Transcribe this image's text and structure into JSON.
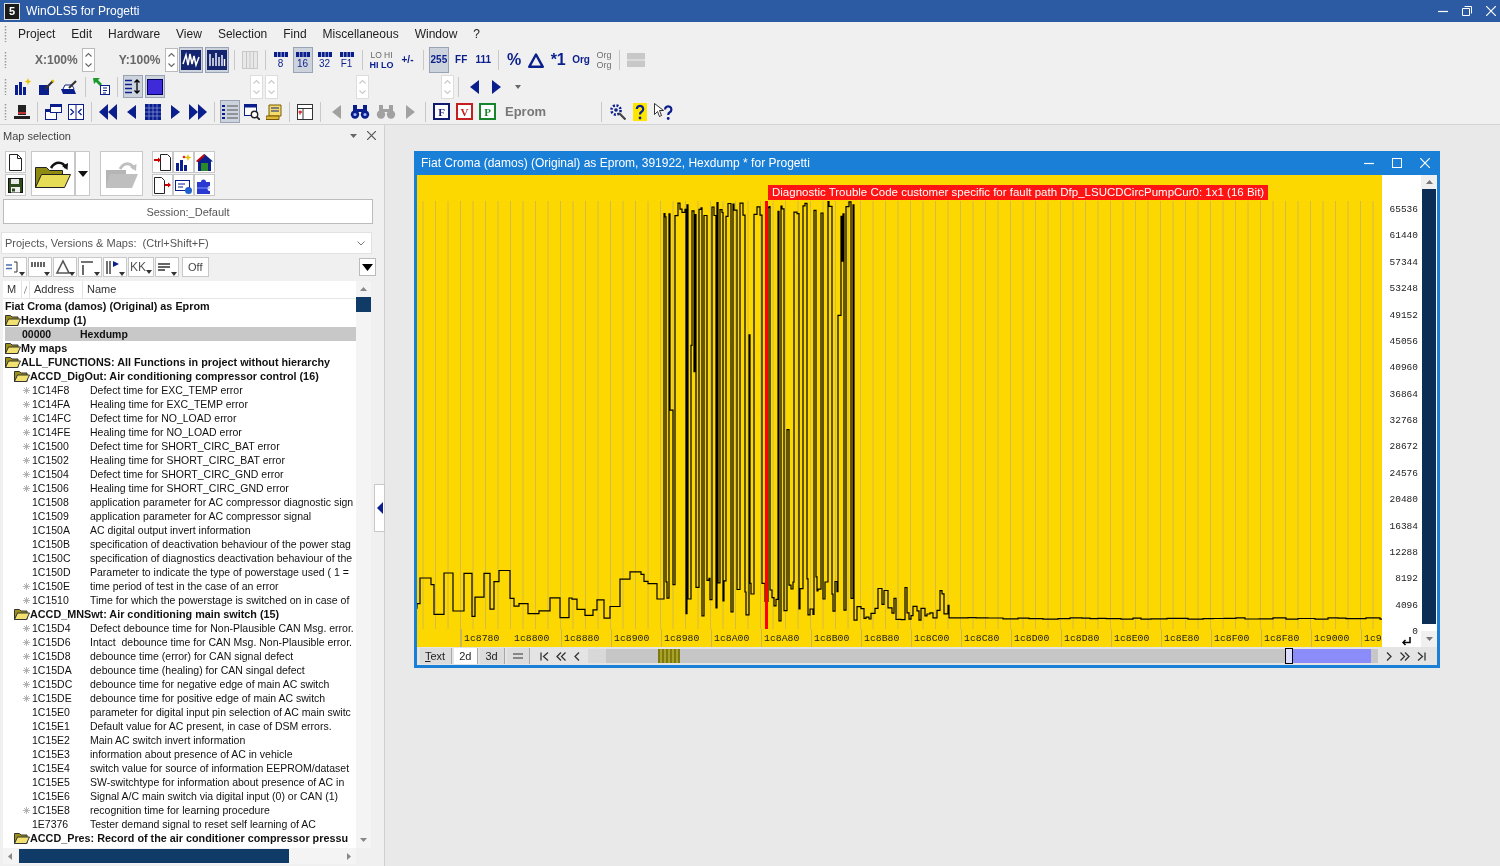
{
  "app": {
    "logo": "5",
    "title": "WinOLS5 for Progetti"
  },
  "menu": [
    "Project",
    "Edit",
    "Hardware",
    "View",
    "Selection",
    "Find",
    "Miscellaneous",
    "Window",
    "?"
  ],
  "toolbar": [
    {
      "items": [
        {
          "kind": "zoom",
          "label": "X:100%"
        },
        {
          "kind": "zoom",
          "label": "Y:100%"
        },
        {
          "kind": "icon",
          "pressed": true,
          "disabled": false
        },
        {
          "kind": "icon",
          "pressed": true,
          "disabled": false
        },
        {
          "kind": "separator"
        },
        {
          "kind": "icon",
          "pressed": false,
          "disabled": true
        },
        {
          "kind": "separator"
        },
        {
          "kind": "bits",
          "label": "8",
          "pressed": false,
          "disabled": false
        },
        {
          "kind": "bits",
          "label": "16",
          "pressed": true,
          "disabled": false
        },
        {
          "kind": "bits",
          "label": "32",
          "pressed": false,
          "disabled": false
        },
        {
          "kind": "bits",
          "label": "F1",
          "pressed": false,
          "disabled": false
        },
        {
          "kind": "separator"
        },
        {
          "kind": "stacked",
          "top": "LO HI",
          "bottom": "HI LO",
          "pressed": false,
          "disabled": false
        },
        {
          "kind": "glyph",
          "label": "+/-",
          "pressed": false,
          "disabled": false
        },
        {
          "kind": "separator"
        },
        {
          "kind": "glyph",
          "label": "255",
          "pressed": true,
          "disabled": false
        },
        {
          "kind": "glyph",
          "label": "FF",
          "pressed": false,
          "disabled": false
        },
        {
          "kind": "glyph",
          "label": "111",
          "pressed": false,
          "disabled": false
        },
        {
          "kind": "separator"
        },
        {
          "kind": "symbol",
          "label": "%",
          "pressed": false,
          "disabled": false
        },
        {
          "kind": "icon",
          "pressed": false,
          "disabled": false
        },
        {
          "kind": "symbol",
          "label": "*1",
          "pressed": false,
          "disabled": false
        },
        {
          "kind": "glyph",
          "label": "Org",
          "pressed": false,
          "disabled": false
        },
        {
          "kind": "stacked",
          "top": "Org",
          "bottom": "Org",
          "pressed": false,
          "disabled": true
        },
        {
          "kind": "separator"
        },
        {
          "kind": "icon",
          "pressed": false,
          "disabled": true
        }
      ]
    },
    {
      "items": [
        {
          "kind": "icon",
          "pressed": false,
          "disabled": false
        },
        {
          "kind": "icon",
          "pressed": false,
          "disabled": false
        },
        {
          "kind": "icon",
          "pressed": false,
          "disabled": false
        },
        {
          "kind": "separator"
        },
        {
          "kind": "icon",
          "pressed": false,
          "disabled": false
        },
        {
          "kind": "separator"
        },
        {
          "kind": "icon",
          "pressed": true,
          "disabled": false
        },
        {
          "kind": "icon",
          "pressed": true,
          "disabled": false
        },
        {
          "kind": "spin",
          "disabled": true
        },
        {
          "kind": "spin",
          "disabled": true
        },
        {
          "kind": "spin",
          "disabled": true
        },
        {
          "kind": "spin",
          "disabled": true
        },
        {
          "kind": "separator"
        },
        {
          "kind": "icon",
          "pressed": false,
          "disabled": false
        },
        {
          "kind": "icon",
          "pressed": false,
          "disabled": false
        },
        {
          "kind": "icon",
          "pressed": false,
          "disabled": false
        }
      ]
    },
    {
      "items": [
        {
          "kind": "icon",
          "pressed": false,
          "disabled": false
        },
        {
          "kind": "separator"
        },
        {
          "kind": "icon",
          "pressed": false,
          "disabled": false
        },
        {
          "kind": "icon",
          "pressed": false,
          "disabled": false
        },
        {
          "kind": "separator"
        },
        {
          "kind": "icon",
          "pressed": false,
          "disabled": false
        },
        {
          "kind": "icon",
          "pressed": false,
          "disabled": false
        },
        {
          "kind": "icon",
          "pressed": false,
          "disabled": false
        },
        {
          "kind": "icon",
          "pressed": false,
          "disabled": false
        },
        {
          "kind": "icon",
          "pressed": false,
          "disabled": false
        },
        {
          "kind": "separator"
        },
        {
          "kind": "icon",
          "pressed": true,
          "disabled": false
        },
        {
          "kind": "icon",
          "pressed": false,
          "disabled": false
        },
        {
          "kind": "icon",
          "pressed": false,
          "disabled": false
        },
        {
          "kind": "separator"
        },
        {
          "kind": "icon",
          "pressed": false,
          "disabled": false
        },
        {
          "kind": "separator"
        },
        {
          "kind": "icon",
          "pressed": false,
          "disabled": true
        },
        {
          "kind": "icon",
          "pressed": false,
          "disabled": false
        },
        {
          "kind": "icon",
          "pressed": false,
          "disabled": true
        },
        {
          "kind": "icon",
          "pressed": false,
          "disabled": true
        },
        {
          "kind": "separator"
        },
        {
          "kind": "letter",
          "label": "F",
          "color": "#101c6e",
          "pressed": false,
          "disabled": false
        },
        {
          "kind": "letter",
          "label": "V",
          "color": "#c41e1e",
          "pressed": false,
          "disabled": false
        },
        {
          "kind": "letter",
          "label": "P",
          "color": "#16852c",
          "pressed": false,
          "disabled": false
        },
        {
          "kind": "label",
          "label": "Eprom"
        },
        {
          "kind": "separator"
        },
        {
          "kind": "icon",
          "pressed": false,
          "disabled": false
        },
        {
          "kind": "icon",
          "pressed": false,
          "disabled": false
        },
        {
          "kind": "icon",
          "pressed": false,
          "disabled": false
        }
      ]
    }
  ],
  "map_selection": {
    "title": "Map selection",
    "file_buttons": [
      {
        "disabled": false
      },
      {
        "disabled": false
      },
      {
        "disabled": false
      },
      {
        "disabled": false
      },
      {
        "disabled": true
      },
      {
        "disabled": false
      },
      {
        "disabled": false
      },
      {
        "disabled": false
      },
      {
        "disabled": false
      },
      {
        "disabled": false
      },
      {
        "disabled": false
      }
    ],
    "session": "Session:_Default",
    "search": {
      "placeholder": "Projects, Versions & Maps:  (Ctrl+Shift+F)"
    },
    "filter_bar": {
      "letters": "KK",
      "toggle": "Off"
    },
    "columns": [
      "M",
      "Address",
      "Name"
    ],
    "tree": [
      {
        "kind": "project",
        "label": "Fiat Croma (damos) (Original) as Eprom",
        "children": [
          {
            "kind": "folder",
            "label": "Hexdump (1)",
            "children": [
              {
                "kind": "map",
                "address": "00000",
                "name": "Hexdump",
                "marked": false,
                "selected": true
              }
            ]
          },
          {
            "kind": "folder",
            "label": "My maps"
          },
          {
            "kind": "folder",
            "label": "ALL_FUNCTIONS: All Functions in project without hierarchy",
            "children": [
              {
                "kind": "folder",
                "label": "ACCD_DigOut: Air conditioning compressor control (16)",
                "children": [
                  {
                    "kind": "map",
                    "address": "1C14F8",
                    "name": "Defect time for EXC_TEMP error",
                    "marked": true,
                    "selected": false
                  },
                  {
                    "kind": "map",
                    "address": "1C14FA",
                    "name": "Healing time for EXC_TEMP error",
                    "marked": true,
                    "selected": false
                  },
                  {
                    "kind": "map",
                    "address": "1C14FC",
                    "name": "Defect time for NO_LOAD error",
                    "marked": true,
                    "selected": false
                  },
                  {
                    "kind": "map",
                    "address": "1C14FE",
                    "name": "Healing time for NO_LOAD error",
                    "marked": true,
                    "selected": false
                  },
                  {
                    "kind": "map",
                    "address": "1C1500",
                    "name": "Defect time for SHORT_CIRC_BAT error",
                    "marked": true,
                    "selected": false
                  },
                  {
                    "kind": "map",
                    "address": "1C1502",
                    "name": "Healing time for SHORT_CIRC_BAT error",
                    "marked": true,
                    "selected": false
                  },
                  {
                    "kind": "map",
                    "address": "1C1504",
                    "name": "Defect time for SHORT_CIRC_GND error",
                    "marked": true,
                    "selected": false
                  },
                  {
                    "kind": "map",
                    "address": "1C1506",
                    "name": "Healing time for SHORT_CIRC_GND error",
                    "marked": true,
                    "selected": false
                  },
                  {
                    "kind": "map",
                    "address": "1C1508",
                    "name": "application parameter for AC compressor diagnostic sign",
                    "marked": false,
                    "selected": false
                  },
                  {
                    "kind": "map",
                    "address": "1C1509",
                    "name": "application parameter for AC compressor signal",
                    "marked": false,
                    "selected": false
                  },
                  {
                    "kind": "map",
                    "address": "1C150A",
                    "name": "AC digital output invert information",
                    "marked": false,
                    "selected": false
                  },
                  {
                    "kind": "map",
                    "address": "1C150B",
                    "name": "specification of deactivation behaviour of the power stag",
                    "marked": false,
                    "selected": false
                  },
                  {
                    "kind": "map",
                    "address": "1C150C",
                    "name": "specification of diagnostics deactivation behaviour of the",
                    "marked": false,
                    "selected": false
                  },
                  {
                    "kind": "map",
                    "address": "1C150D",
                    "name": "Parameter to indicate the type of powerstage used ( 1 =",
                    "marked": false,
                    "selected": false
                  },
                  {
                    "kind": "map",
                    "address": "1C150E",
                    "name": "time period of test in the case of an error",
                    "marked": true,
                    "selected": false
                  },
                  {
                    "kind": "map",
                    "address": "1C1510",
                    "name": "Time for which the powerstage is switched on in case of",
                    "marked": true,
                    "selected": false
                  }
                ]
              },
              {
                "kind": "folder",
                "label": "ACCD_MNSwt: Air conditioning main switch (15)",
                "children": [
                  {
                    "kind": "map",
                    "address": "1C15D4",
                    "name": "Defect debounce time for Non-Plausible CAN Msg. error.",
                    "marked": true,
                    "selected": false
                  },
                  {
                    "kind": "map",
                    "address": "1C15D6",
                    "name": "Intact  debounce time for CAN Msg. Non-Plausible error.",
                    "marked": true,
                    "selected": false
                  },
                  {
                    "kind": "map",
                    "address": "1C15D8",
                    "name": "debounce time (error) for CAN signal defect",
                    "marked": true,
                    "selected": false
                  },
                  {
                    "kind": "map",
                    "address": "1C15DA",
                    "name": "debounce time (healing) for CAN singal defect",
                    "marked": true,
                    "selected": false
                  },
                  {
                    "kind": "map",
                    "address": "1C15DC",
                    "name": "debounce time for negative edge of main AC switch",
                    "marked": true,
                    "selected": false
                  },
                  {
                    "kind": "map",
                    "address": "1C15DE",
                    "name": "debounce time for positive edge of main AC switch",
                    "marked": true,
                    "selected": false
                  },
                  {
                    "kind": "map",
                    "address": "1C15E0",
                    "name": "parameter for digital input pin selection of AC main switc",
                    "marked": false,
                    "selected": false
                  },
                  {
                    "kind": "map",
                    "address": "1C15E1",
                    "name": "Default value for AC present, in case of DSM errors.",
                    "marked": false,
                    "selected": false
                  },
                  {
                    "kind": "map",
                    "address": "1C15E2",
                    "name": "Main AC switch invert information",
                    "marked": false,
                    "selected": false
                  },
                  {
                    "kind": "map",
                    "address": "1C15E3",
                    "name": "information about presence of AC in vehicle",
                    "marked": false,
                    "selected": false
                  },
                  {
                    "kind": "map",
                    "address": "1C15E4",
                    "name": "switch value for source of information EEPROM/dataset",
                    "marked": false,
                    "selected": false
                  },
                  {
                    "kind": "map",
                    "address": "1C15E5",
                    "name": "SW-switchtype for information about presence of AC in",
                    "marked": false,
                    "selected": false
                  },
                  {
                    "kind": "map",
                    "address": "1C15E6",
                    "name": "Signal A/C main switch via digital input (0) or CAN (1)",
                    "marked": false,
                    "selected": false
                  },
                  {
                    "kind": "map",
                    "address": "1C15E8",
                    "name": "recognition time for learning procedure",
                    "marked": true,
                    "selected": false
                  },
                  {
                    "kind": "map",
                    "address": "1E7376",
                    "name": "Tester demand signal to reset self learning of AC",
                    "marked": false,
                    "selected": false
                  }
                ]
              },
              {
                "kind": "folder",
                "label": "ACCD_Pres: Record of the air conditioner compressor pressu"
              }
            ]
          }
        ]
      }
    ]
  },
  "hexdump_window": {
    "title": "Fiat Croma (damos) (Original) as Eprom, 391922, Hexdump * for Progetti",
    "tooltip": "Diagnostic Trouble Code customer specific for fault path Dfp_LSUCDCircPumpCur0: 1x1 (16 Bit)",
    "y_axis_labels": [
      "65536",
      "61440",
      "57344",
      "53248",
      "49152",
      "45056",
      "40960",
      "36864",
      "32768",
      "28672",
      "24576",
      "20480",
      "16384",
      "12288",
      "8192",
      "4096",
      "0"
    ],
    "x_axis_labels": [
      "1c8780",
      "1c8800",
      "1c8880",
      "1c8900",
      "1c8980",
      "1c8A00",
      "1c8A80",
      "1c8B00",
      "1c8B80",
      "1c8C00",
      "1c8C80",
      "1c8D00",
      "1c8D80",
      "1c8E00",
      "1c8E80",
      "1c8F00",
      "1c8F80",
      "1c9000",
      "1c9"
    ],
    "view_tabs": [
      {
        "kind": "text",
        "label": "Text",
        "selected": false
      },
      {
        "kind": "text",
        "label": "2d",
        "selected": true
      },
      {
        "kind": "text",
        "label": "3d",
        "selected": false
      },
      {
        "kind": "icon",
        "selected": false
      }
    ]
  }
}
